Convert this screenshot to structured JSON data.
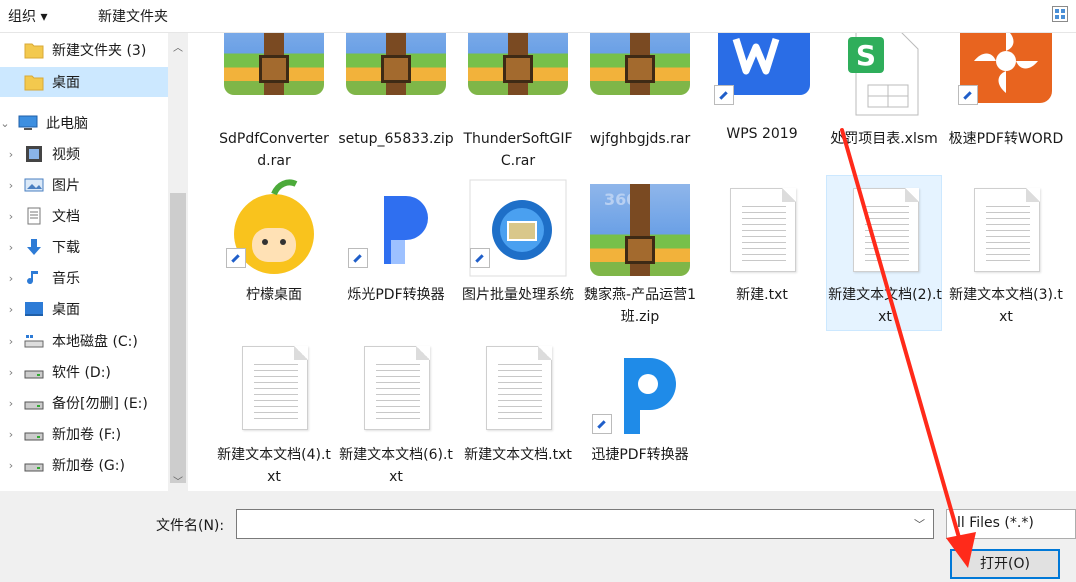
{
  "toolbar": {
    "organize": "组织 ▾",
    "new_folder": "新建文件夹"
  },
  "nav": [
    {
      "label": "新建文件夹 (3)",
      "icon": "folder-icon",
      "arrow": ""
    },
    {
      "label": "桌面",
      "icon": "folder-icon",
      "arrow": "",
      "selected": true
    },
    {
      "label": "此电脑",
      "icon": "computer-icon",
      "arrow": "⌄"
    },
    {
      "label": "视频",
      "icon": "video-icon",
      "arrow": "›"
    },
    {
      "label": "图片",
      "icon": "pictures-icon",
      "arrow": "›"
    },
    {
      "label": "文档",
      "icon": "documents-icon",
      "arrow": "›"
    },
    {
      "label": "下载",
      "icon": "download-icon",
      "arrow": "›"
    },
    {
      "label": "音乐",
      "icon": "music-icon",
      "arrow": "›"
    },
    {
      "label": "桌面",
      "icon": "desktop-icon",
      "arrow": "›"
    },
    {
      "label": "本地磁盘 (C:)",
      "icon": "drive-icon",
      "arrow": "›"
    },
    {
      "label": "软件 (D:)",
      "icon": "drive-icon",
      "arrow": "›"
    },
    {
      "label": "备份[勿删] (E:)",
      "icon": "drive-icon",
      "arrow": "›"
    },
    {
      "label": "新加卷 (F:)",
      "icon": "drive-icon",
      "arrow": "›"
    },
    {
      "label": "新加卷 (G:)",
      "icon": "drive-icon",
      "arrow": "›"
    }
  ],
  "files": [
    {
      "name": "SdPdfConverterd.rar",
      "icon": "rar-archive-icon"
    },
    {
      "name": "setup_65833.zip",
      "icon": "zip-archive-icon"
    },
    {
      "name": "ThunderSoftGIFC.rar",
      "icon": "rar-archive-icon"
    },
    {
      "name": "wjfghbgjds.rar",
      "icon": "rar-archive-icon"
    },
    {
      "name": "WPS 2019",
      "icon": "wps-app-icon",
      "shortcut": true
    },
    {
      "name": "处罚项目表.xlsm",
      "icon": "spreadsheet-icon"
    },
    {
      "name": "极速PDF转WORD",
      "icon": "pdf-word-app-icon",
      "shortcut": true
    },
    {
      "name": "柠檬桌面",
      "icon": "lemon-desktop-app-icon",
      "shortcut": true
    },
    {
      "name": "烁光PDF转换器",
      "icon": "shuoguang-pdf-app-icon",
      "shortcut": true
    },
    {
      "name": "图片批量处理系统",
      "icon": "image-batch-app-icon",
      "shortcut": true
    },
    {
      "name": "魏家燕-产品运营1班.zip",
      "icon": "zip-archive-icon"
    },
    {
      "name": "新建.txt",
      "icon": "text-file-icon"
    },
    {
      "name": "新建文本文档(2).txt",
      "icon": "text-file-icon",
      "selected": true
    },
    {
      "name": "新建文本文档(3).txt",
      "icon": "text-file-icon"
    },
    {
      "name": "新建文本文档(4).txt",
      "icon": "text-file-icon"
    },
    {
      "name": "新建文本文档(6).txt",
      "icon": "text-file-icon"
    },
    {
      "name": "新建文本文档.txt",
      "icon": "text-file-icon"
    },
    {
      "name": "迅捷PDF转换器",
      "icon": "xunjie-pdf-app-icon",
      "shortcut": true
    }
  ],
  "footer": {
    "filename_label": "文件名(N):",
    "filename_value": "",
    "filetype": "ll Files (*.*)",
    "open_button": "打开(O)"
  },
  "colors": {
    "selection": "#cce8ff",
    "accent": "#0078d7",
    "annotation": "#ff2a1a"
  }
}
